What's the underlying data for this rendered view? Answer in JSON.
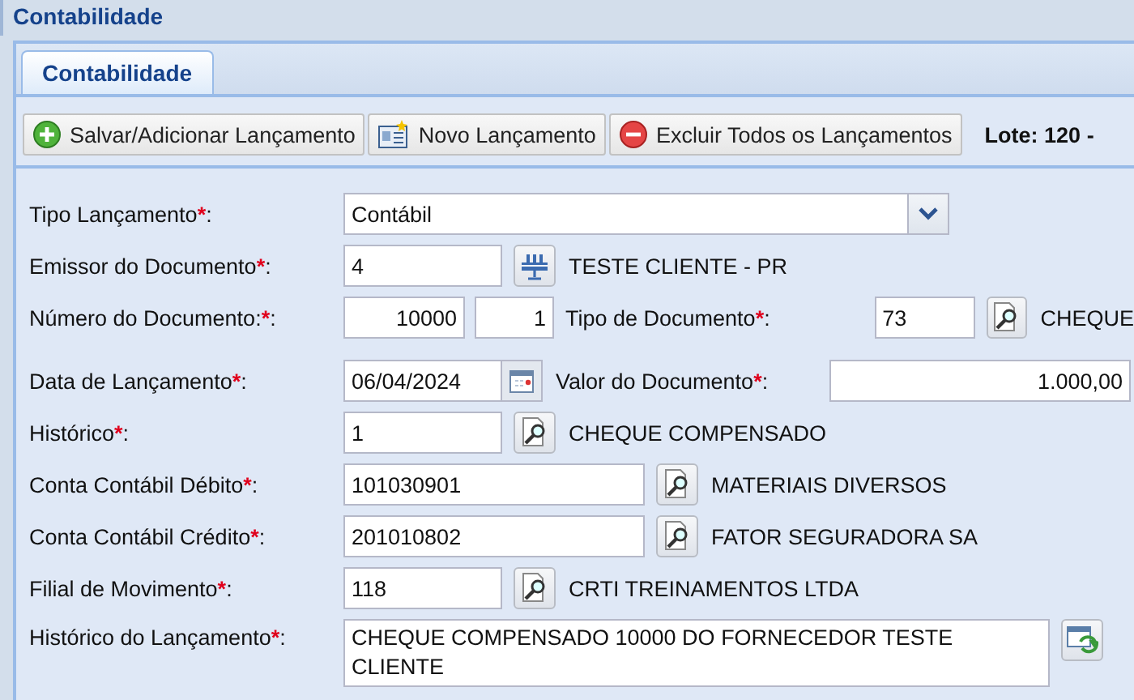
{
  "window": {
    "title": "Contabilidade"
  },
  "tabs": [
    {
      "label": "Contabilidade",
      "selected": true
    }
  ],
  "toolbar": {
    "buttons": [
      {
        "kind": "add",
        "label": "Salvar/Adicionar Lançamento"
      },
      {
        "kind": "new",
        "label": "Novo Lançamento"
      },
      {
        "kind": "delete",
        "label": "Excluir Todos os Lançamentos"
      }
    ],
    "batch": "Lote: 120 -"
  },
  "form": {
    "rows": [
      {
        "kind": "select",
        "label": "Tipo Lançamento",
        "required_mark": "*",
        "suffix": ":",
        "value": "Contábil"
      },
      {
        "kind": "emitter_lookup",
        "label": "Emissor do Documento",
        "required_mark": "*",
        "suffix": ":",
        "value": "4",
        "description": "TESTE CLIENTE - PR"
      },
      {
        "kind": "document_number",
        "label": "Número do Documento:",
        "required_mark": "*",
        "suffix": ":",
        "value": "10000",
        "series": "1",
        "doc_type": {
          "label": "Tipo de Documento",
          "required_mark": "*",
          "suffix": ":",
          "value": "73",
          "description": "CHEQUE"
        }
      },
      {
        "kind": "date_amount",
        "label": "Data de Lançamento",
        "required_mark": "*",
        "suffix": ":",
        "value": "06/04/2024",
        "amount": {
          "label": "Valor do Documento",
          "required_mark": "*",
          "suffix": ":",
          "value": "1.000,00"
        }
      },
      {
        "kind": "lookup",
        "label": "Histórico",
        "required_mark": "*",
        "suffix": ":",
        "value": "1",
        "description": "CHEQUE COMPENSADO"
      },
      {
        "kind": "account_lookup",
        "label": "Conta Contábil Débito",
        "required_mark": "*",
        "suffix": ":",
        "value": "101030901",
        "description": "MATERIAIS DIVERSOS"
      },
      {
        "kind": "account_lookup",
        "label": "Conta Contábil Crédito",
        "required_mark": "*",
        "suffix": ":",
        "value": "201010802",
        "description": "FATOR SEGURADORA SA"
      },
      {
        "kind": "lookup",
        "label": "Filial de Movimento",
        "required_mark": "*",
        "suffix": ":",
        "value": "118",
        "description": "CRTI TREINAMENTOS LTDA"
      },
      {
        "kind": "memo",
        "label": "Histórico do Lançamento",
        "required_mark": "*",
        "suffix": ":",
        "value": "CHEQUE COMPENSADO 10000 DO FORNECEDOR TESTE CLIENTE"
      }
    ]
  }
}
